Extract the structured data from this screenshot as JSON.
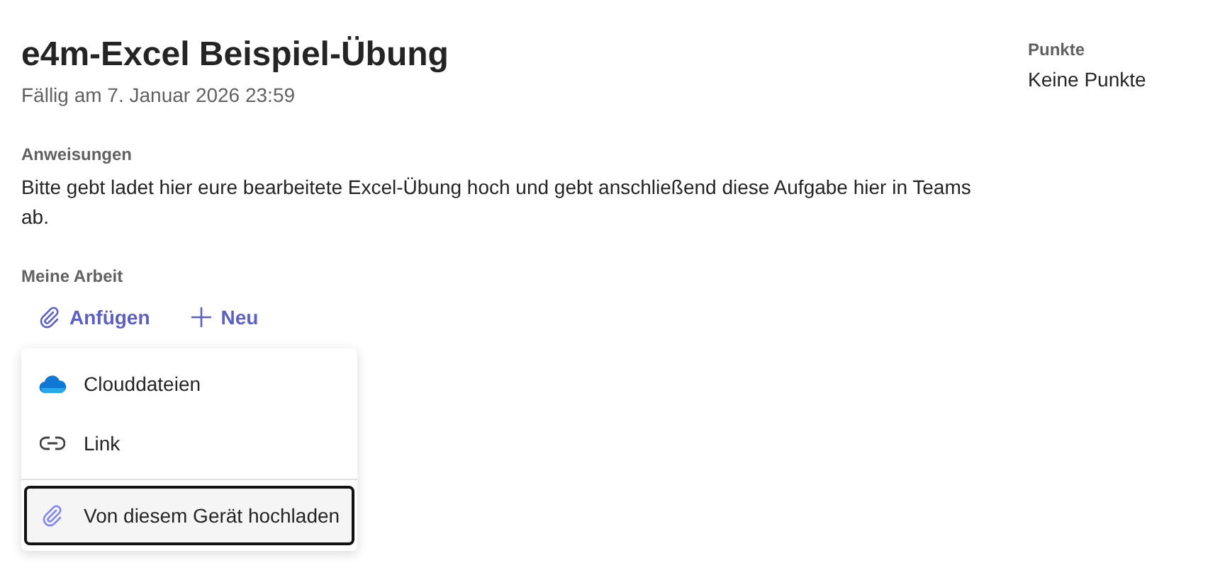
{
  "assignment": {
    "title": "e4m-Excel Beispiel-Übung",
    "due": "Fällig am 7. Januar 2026 23:59"
  },
  "instructions": {
    "label": "Anweisungen",
    "text": "Bitte gebt ladet hier eure bearbeitete Excel-Übung hoch und gebt anschließend diese Aufgabe hier in Teams ab."
  },
  "my_work": {
    "label": "Meine Arbeit",
    "actions": [
      {
        "kind": "attach",
        "label": "Anfügen"
      },
      {
        "kind": "new",
        "label": "Neu"
      }
    ]
  },
  "attach_menu": {
    "items": [
      {
        "kind": "cloud",
        "label": "Clouddateien",
        "focused": false
      },
      {
        "kind": "link",
        "label": "Link",
        "focused": false
      },
      {
        "kind": "upload",
        "label": "Von diesem Gerät hochladen",
        "focused": true
      }
    ]
  },
  "points": {
    "label": "Punkte",
    "value": "Keine Punkte"
  }
}
